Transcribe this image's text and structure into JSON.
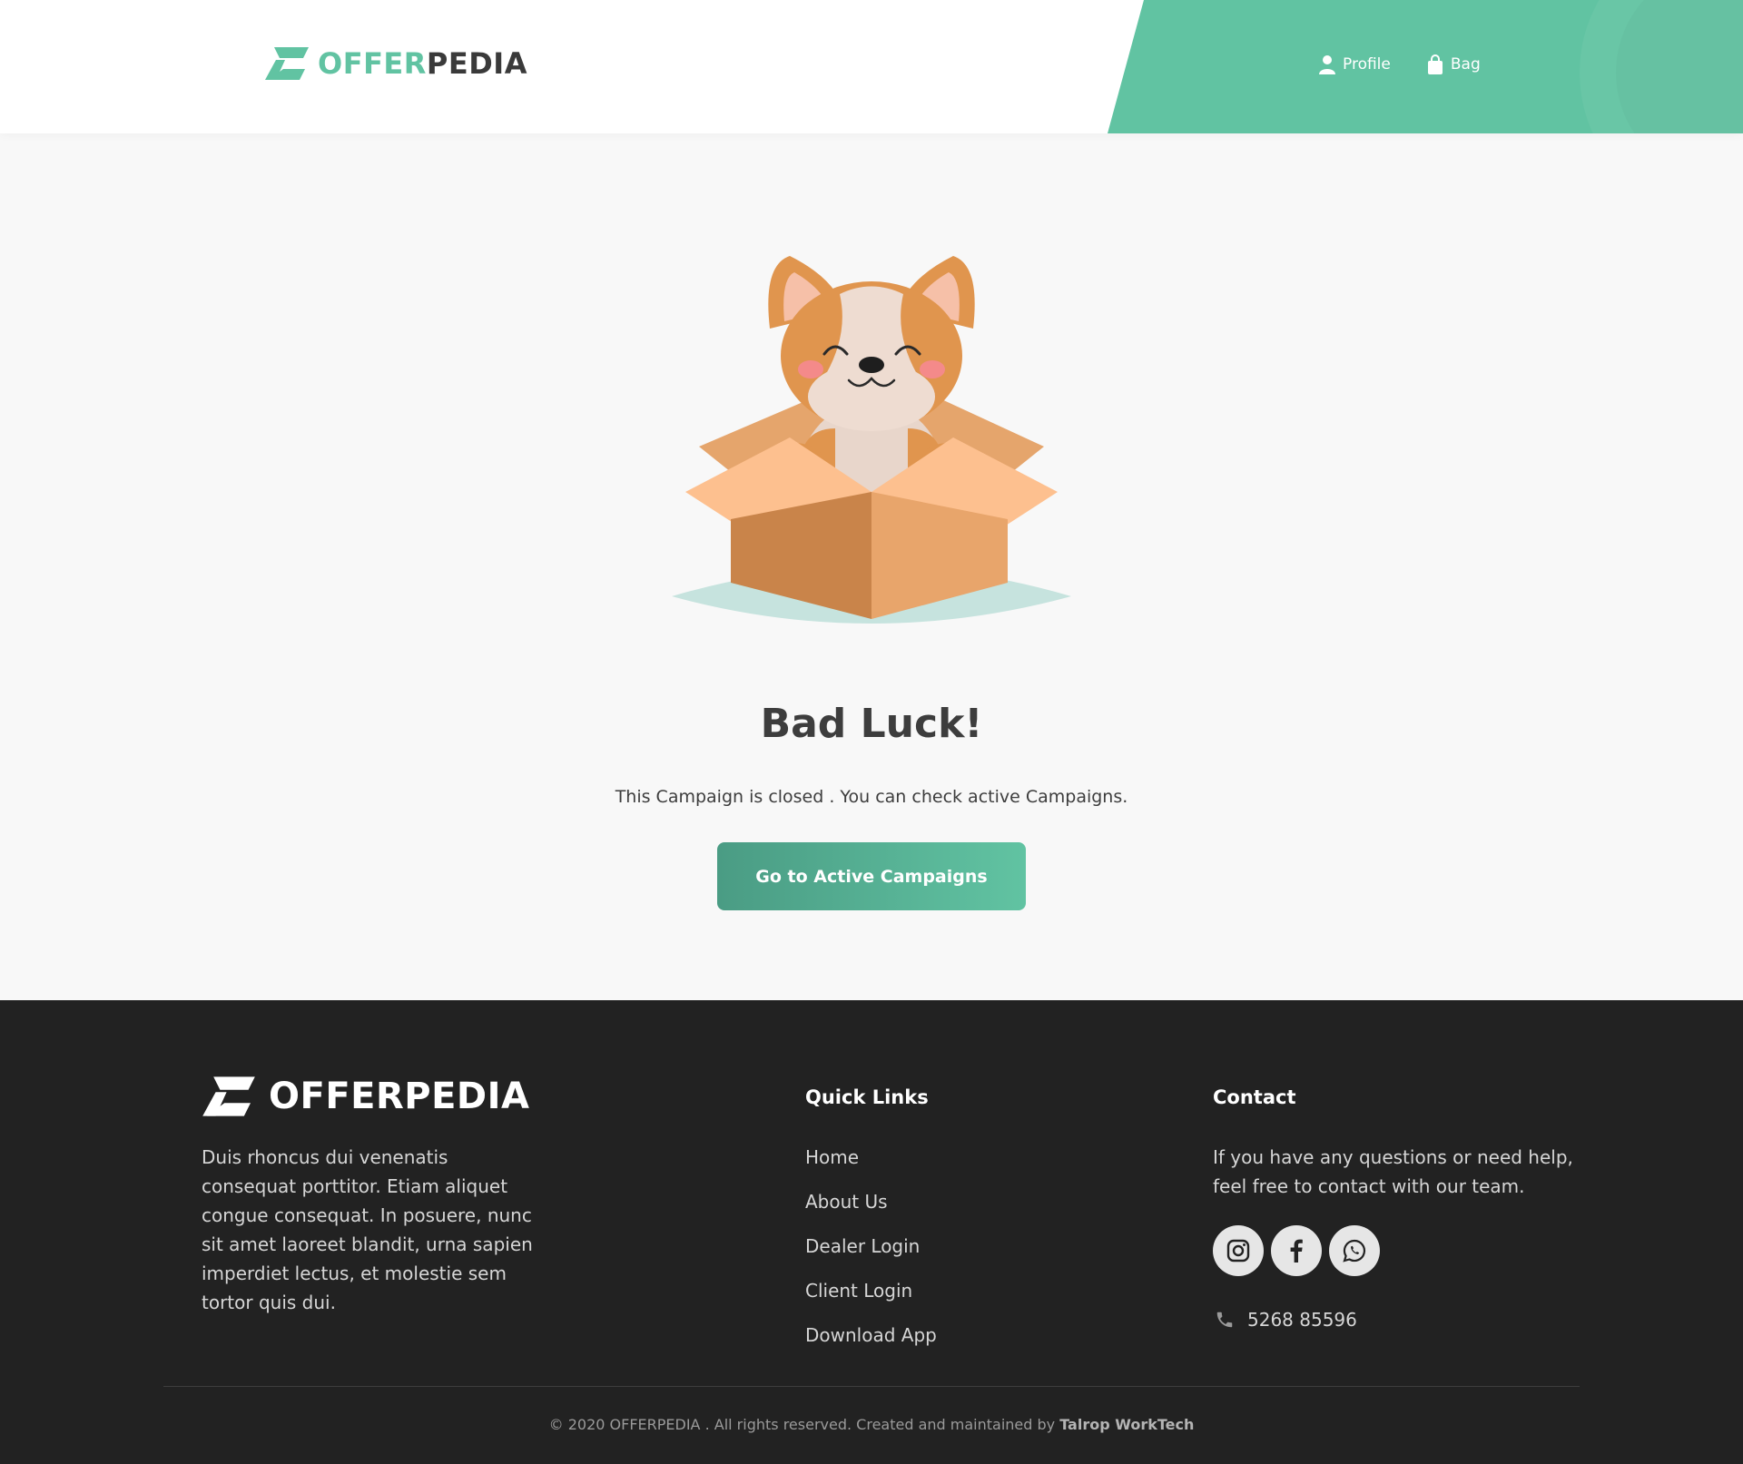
{
  "header": {
    "logo": {
      "part1": "OFFER",
      "part2": "PEDIA"
    },
    "nav": {
      "profile": "Profile",
      "bag": "Bag"
    }
  },
  "main": {
    "title": "Bad Luck!",
    "message": "This Campaign is closed . You can check active Campaigns.",
    "cta_label": "Go to Active Campaigns"
  },
  "footer": {
    "logo": "OFFERPEDIA",
    "about": "Duis rhoncus dui venenatis consequat porttitor. Etiam aliquet congue consequat. In posuere, nunc sit amet laoreet blandit, urna sapien imperdiet lectus, et molestie sem tortor quis dui.",
    "quick_links_title": "Quick Links",
    "quick_links": [
      "Home",
      "About Us",
      "Dealer Login",
      "Client Login",
      "Download App"
    ],
    "contact_title": "Contact",
    "contact_text": "If you have any questions or need help, feel free to contact with our team.",
    "phone": "5268 85596",
    "social": [
      "instagram-icon",
      "facebook-icon",
      "whatsapp-icon"
    ],
    "copyright": "© 2020 OFFERPEDIA . All rights reserved. Created and maintained by",
    "company": "Talrop WorkTech"
  },
  "colors": {
    "brand": "#61c3a2",
    "brand_dark": "#4a9c84",
    "text": "#3d3d3d",
    "footer_bg": "#222222"
  }
}
